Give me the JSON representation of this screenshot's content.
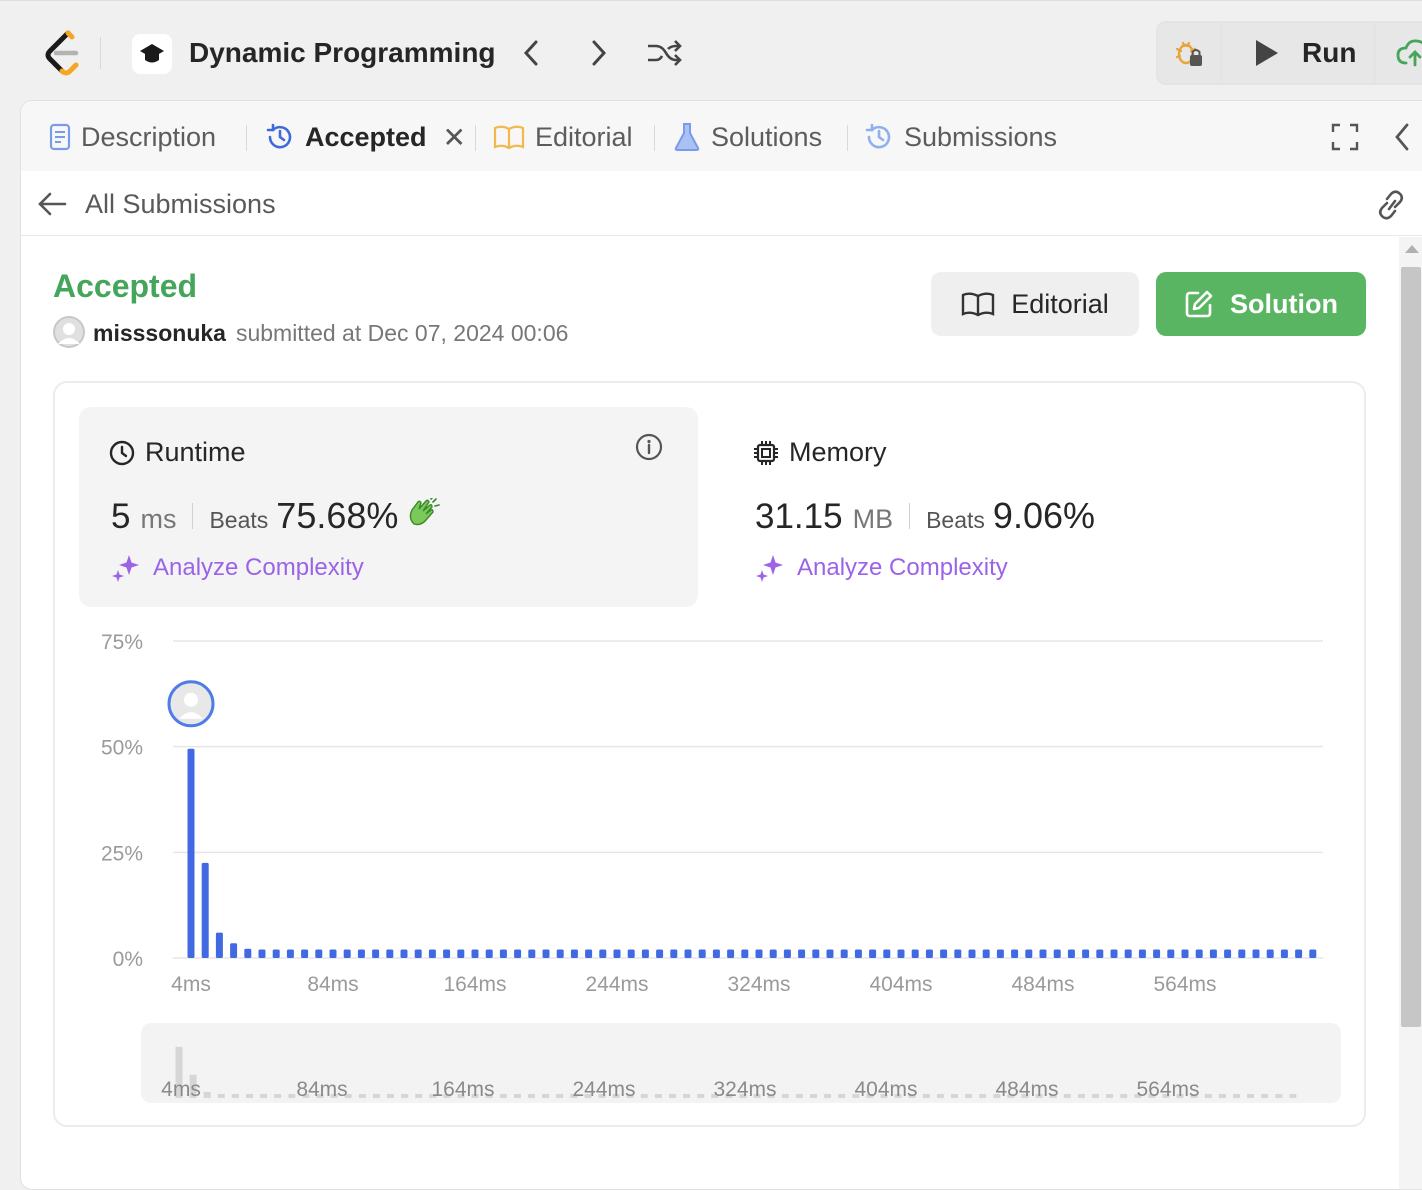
{
  "topbar": {
    "study_title": "Dynamic Programming",
    "run_label": "Run",
    "icons": [
      "leetcode-logo-icon",
      "graduation-cap-icon",
      "chevron-left-icon",
      "chevron-right-icon",
      "shuffle-icon",
      "debug-bug-lock-icon",
      "play-icon",
      "cloud-upload-icon"
    ]
  },
  "tabs": [
    {
      "label": "Description",
      "icon": "document-icon",
      "active": false
    },
    {
      "label": "Accepted",
      "icon": "history-icon",
      "active": true,
      "closable": true
    },
    {
      "label": "Editorial",
      "icon": "book-icon",
      "active": false
    },
    {
      "label": "Solutions",
      "icon": "flask-icon",
      "active": false
    },
    {
      "label": "Submissions",
      "icon": "history-icon",
      "active": false
    }
  ],
  "subheader": {
    "back_label": "All Submissions"
  },
  "result": {
    "status": "Accepted",
    "username": "misssonuka",
    "submitted_text": "submitted at Dec 07, 2024 00:06",
    "editorial_button": "Editorial",
    "solution_button": "Solution"
  },
  "runtime": {
    "title": "Runtime",
    "value": "5",
    "unit": "ms",
    "beats_label": "Beats",
    "beats_pct": "75.68%",
    "analyze_label": "Analyze Complexity"
  },
  "memory": {
    "title": "Memory",
    "value": "31.15",
    "unit": "MB",
    "beats_label": "Beats",
    "beats_pct": "9.06%",
    "analyze_label": "Analyze Complexity"
  },
  "colors": {
    "accepted_green": "#45a55a",
    "solution_button": "#5ab562",
    "bar_blue": "#4169e1",
    "analyze_purple": "#9a63e8"
  },
  "chart_data": {
    "type": "bar",
    "title": "",
    "xlabel": "",
    "ylabel": "",
    "ylim": [
      0,
      75
    ],
    "y_ticks": [
      "0%",
      "25%",
      "50%",
      "75%"
    ],
    "x_ticks": [
      "4ms",
      "84ms",
      "164ms",
      "244ms",
      "324ms",
      "404ms",
      "484ms",
      "564ms"
    ],
    "x_start_ms": 4,
    "x_step_ms": 8,
    "values": [
      49.5,
      22.5,
      6,
      3.5,
      2.2,
      2,
      2,
      2,
      2,
      2,
      2,
      2,
      2,
      2,
      2,
      2,
      2,
      2,
      2,
      2,
      2,
      2,
      2,
      2,
      2,
      2,
      2,
      2,
      2,
      2,
      2,
      2,
      2,
      2,
      2,
      2,
      2,
      2,
      2,
      2,
      2,
      2,
      2,
      2,
      2,
      2,
      2,
      2,
      2,
      2,
      2,
      2,
      2,
      2,
      2,
      2,
      2,
      2,
      2,
      2,
      2,
      2,
      2,
      2,
      2,
      2,
      2,
      2,
      2,
      2,
      2,
      2,
      2,
      2,
      2,
      2,
      2,
      2,
      2,
      2
    ],
    "highlight_index": 0,
    "grid": true,
    "minimap_labels": [
      "4ms",
      "84ms",
      "164ms",
      "244ms",
      "324ms",
      "404ms",
      "484ms",
      "564ms"
    ]
  }
}
